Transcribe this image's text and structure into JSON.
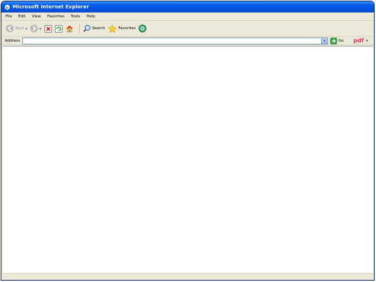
{
  "window": {
    "title": "Microsoft Internet Explorer"
  },
  "menubar": {
    "items": [
      "File",
      "Edit",
      "View",
      "Favorites",
      "Tools",
      "Help"
    ]
  },
  "toolbar": {
    "back_label": "Back",
    "search_label": "Search",
    "favorites_label": "Favorites"
  },
  "address": {
    "label": "Address",
    "value": "",
    "go_label": "Go"
  },
  "pdf": {
    "label": "pdf"
  },
  "colors": {
    "titlebar": "#0054e3",
    "chrome": "#ece9d8",
    "pdf_accent": "#e8325b"
  },
  "icons": [
    "ie-icon",
    "back-icon",
    "forward-icon",
    "stop-icon",
    "refresh-icon",
    "home-icon",
    "search-icon",
    "favorites-icon",
    "media-icon",
    "go-icon"
  ]
}
